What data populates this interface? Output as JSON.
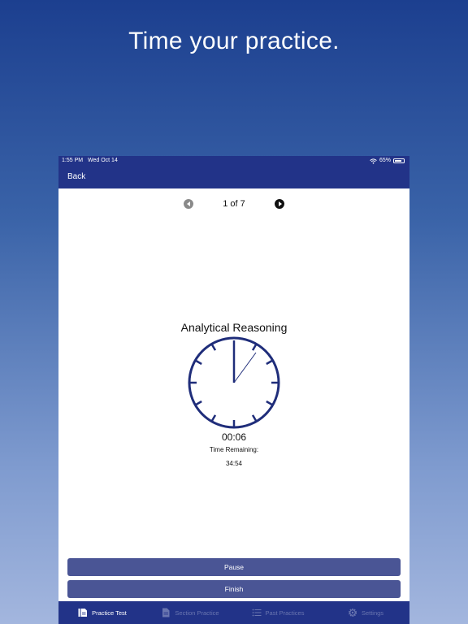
{
  "promo": {
    "title": "Time your practice."
  },
  "status_bar": {
    "time": "1:55 PM",
    "date": "Wed Oct 14",
    "battery": "65%"
  },
  "nav": {
    "back_label": "Back"
  },
  "pager": {
    "label": "1 of 7"
  },
  "section": {
    "title": "Analytical Reasoning"
  },
  "timer": {
    "elapsed": "00:06",
    "remaining_label": "Time Remaining:",
    "remaining_value": "34:54"
  },
  "actions": {
    "pause_label": "Pause",
    "finish_label": "Finish"
  },
  "tabs": [
    {
      "label": "Practice Test",
      "icon": "practice-test-icon",
      "active": true
    },
    {
      "label": "Section Practice",
      "icon": "document-icon",
      "active": false
    },
    {
      "label": "Past Practices",
      "icon": "list-icon",
      "active": false
    },
    {
      "label": "Settings",
      "icon": "gear-icon",
      "active": false
    }
  ],
  "colors": {
    "header": "#223388",
    "button": "#4a5595",
    "clock": "#1f2d7a",
    "tab_inactive": "#6a76b0"
  }
}
